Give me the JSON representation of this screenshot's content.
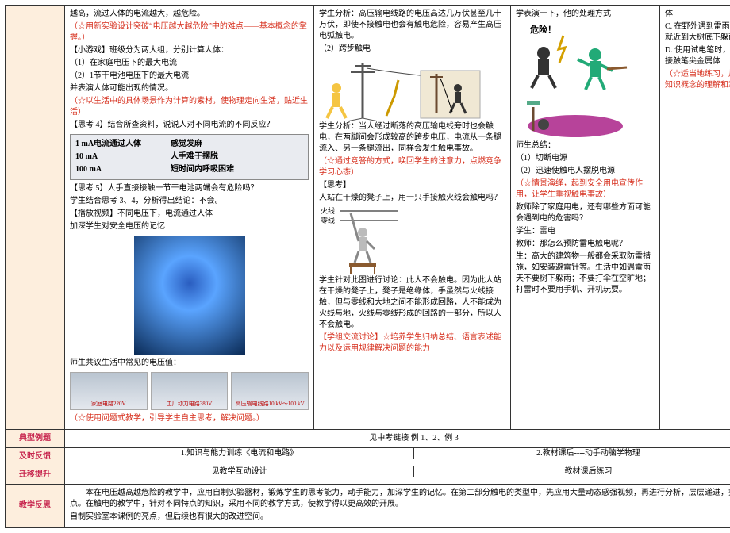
{
  "main": {
    "col1": {
      "l1": "越高，流过人体的电流越大，越危险。",
      "l2": "（☆用新实验设计突破“电压越大越危险”中的难点——基本概念的掌握。）",
      "l3": "【小游戏】班级分为两大组，分别计算人体：",
      "l4": "（1）在家庭电压下的最大电流",
      "l5": "（2）1节干电池电压下的最大电流",
      "l6": "并表演人体可能出现的情况。",
      "l7": "（☆以生活中的具体场景作为计算的素材，使物理走向生活，贴近生活）",
      "l8": "【思考 4】结合所查资料，说说人对不同电流的不同反应？",
      "box_a1": "1 mA电流通过人体",
      "box_b1": "感觉发麻",
      "box_a2": "10 mA",
      "box_b2": "人手难于摆脱",
      "box_a3": "100 mA",
      "box_b3": "短时间内呼吸困难",
      "l9": "【思考 5】人手直接接触一节干电池两端会有危险吗？",
      "l10": "学生结合思考 3、4，分析得出结论：不会。",
      "l11": "【播放视频】不同电压下，电流通过人体",
      "l12": "加深学生对安全电压的记忆",
      "l13": "师生共议生活中常见的电压值：",
      "cap1": "家庭电路220V",
      "cap2": "工厂动力电路380V",
      "cap3": "高压输电线路10 kV～100 kV",
      "l14": "（☆使用问题式教学，引导学生自主思考，解决问题。）"
    },
    "col2": {
      "l1": "学生分析：高压输电线路的电压高达几万伏甚至几十万伏，即使不接触电也会有触电危险，容易产生高压电弧触电。",
      "l2": "（2）跨步触电",
      "l3": "学生分析：当人经过断落的高压输电线旁时也会触电，在两脚间会形成较高的跨步电压，电流从一条腿流入、另一条腿流出，同样会发生触电事故。",
      "l4": "（☆通过竞答的方式，唤回学生的注意力，点燃竞争学习心态）",
      "l5": "【思考】",
      "l6": "人站在干燥的凳子上，用一只手接触火线会触电吗？",
      "lab_fire": "火线",
      "lab_neutral": "零线",
      "l7": "学生针对此图进行讨论：此人不会触电。因为此人站在干燥的凳子上，凳子是绝缘体，手虽然与火线接触，但与零线和大地之间不能形成回路，人不能成为火线与地，火线与零线形成的回路的一部分，所以人不会触电。",
      "l8": "【学组交流讨论】☆培养学生归纳总结、语言表述能力以及运用规律解决问题的能力"
    },
    "col3": {
      "l1": "学表演一下，他的处理方式",
      "lab_danger": "危险！",
      "l2": "师生总结：",
      "l3": "（1）切断电源",
      "l4": "（2）迅速使触电人摆脱电源",
      "l5": "（☆情景演绎，起到安全用电宣传作用，让学生重视触电事故）",
      "l6": "教师除了家庭用电，还有哪些方面可能会遇到电的危害吗？",
      "l7": "学生：雷电",
      "l8": "教师：那怎么预防雷电触电呢？",
      "l9": "生：高大的建筑物一般都会采取防雷措施，如安装避雷针等。生活中如遇雷雨天不要树下躲雨；不要打伞在空旷地；打雷时不要用手机、开机玩耍。"
    },
    "col4": {
      "l1": "体",
      "l2": "C. 在野外遇到雷雨天气应就近到大树底下躲雨",
      "l3": "D. 使用试电笔时，手可以接触笔尖金属体",
      "l4": "（☆适当地练习，加深对知识概念的理解和掌握）"
    }
  },
  "rows": {
    "r1_label": "典型例题",
    "r1_text": "见中考链接 例 1、2、例 3",
    "r2_label": "及时反馈",
    "r2_left": "1.知识与能力训练《电流和电路》",
    "r2_right": "2.教材课后----动手动脑学物理",
    "r3_label": "迁移提升",
    "r3_left": "见教学互动设计",
    "r3_right": "教材课后练习",
    "r4_label": "教学反思",
    "r4_text": "本在电压越高越危险的教学中，应用自制实验器材，锻炼学生的思考能力，动手能力，加深学生的记忆。在第二部分触电的类型中，先应用大量动态感强视频，再进行分析，层层递进，突破难点。在触电的教学中，针对不同特点的知识，采用不同的教学方式，使教学得以更高效的开展。",
    "r4_text2": "自制实验室本课例的亮点，但后续也有很大的改进空间。"
  }
}
